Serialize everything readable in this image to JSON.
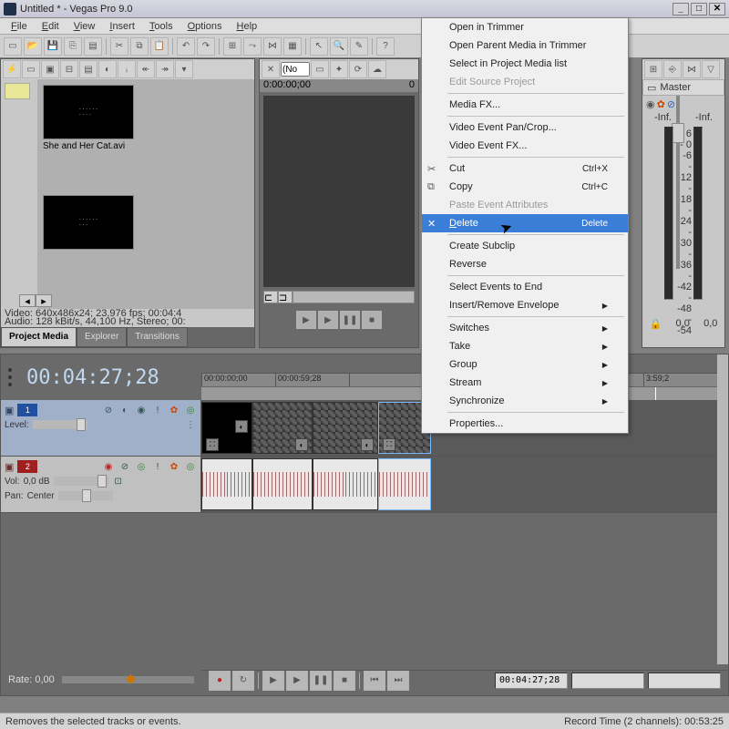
{
  "window": {
    "title": "Untitled * - Vegas Pro 9.0"
  },
  "menubar": [
    "File",
    "Edit",
    "View",
    "Insert",
    "Tools",
    "Options",
    "Help"
  ],
  "project_media": {
    "media_name": "She and Her Cat.avi",
    "info_line1": "Video: 640x486x24; 23,976 fps; 00:04:4",
    "info_line2": "Audio: 128 kBit/s, 44,100 Hz, Stereo; 00:",
    "tabs": [
      "Project Media",
      "Explorer",
      "Transitions"
    ]
  },
  "preview": {
    "dropdown_value": "(No",
    "tc_left": "0:00:00;00",
    "tc_right": "0"
  },
  "master": {
    "title": "Master",
    "inf_left": "-Inf.",
    "inf_right": "-Inf.",
    "ticks": [
      "6",
      "0",
      "-6",
      "-12",
      "-18",
      "-24",
      "-30",
      "-36",
      "-42",
      "-48",
      "-54"
    ],
    "bottom_left": "0,0",
    "bottom_right": "0,0"
  },
  "timeline": {
    "timecode": "00:04:27;28",
    "ruler": [
      "00:00:00;00",
      "00:00:59;28",
      "",
      "",
      "",
      "",
      "3:59;2"
    ],
    "tracks": {
      "video": {
        "num": "1"
      },
      "audio": {
        "num": "2",
        "vol_label": "Vol:",
        "vol_val": "0,0 dB",
        "pan_label": "Pan:",
        "pan_val": "Center"
      }
    },
    "rate_label": "Rate: 0,00",
    "tc_box": "00:04:27;28"
  },
  "context_menu": {
    "items": [
      {
        "label": "Open in Trimmer"
      },
      {
        "label": "Open Parent Media in Trimmer"
      },
      {
        "label": "Select in Project Media list"
      },
      {
        "label": "Edit Source Project",
        "disabled": true
      },
      {
        "sep": true
      },
      {
        "label": "Media FX..."
      },
      {
        "sep": true
      },
      {
        "label": "Video Event Pan/Crop..."
      },
      {
        "label": "Video Event FX..."
      },
      {
        "sep": true
      },
      {
        "label": "Cut",
        "icon": "✂",
        "shortcut": "Ctrl+X"
      },
      {
        "label": "Copy",
        "icon": "⧉",
        "shortcut": "Ctrl+C"
      },
      {
        "label": "Paste Event Attributes",
        "disabled": true
      },
      {
        "label": "Delete",
        "icon": "✕",
        "shortcut": "Delete",
        "highlight": true
      },
      {
        "sep": true
      },
      {
        "label": "Create Subclip"
      },
      {
        "label": "Reverse"
      },
      {
        "sep": true
      },
      {
        "label": "Select Events to End"
      },
      {
        "label": "Insert/Remove Envelope",
        "sub": true
      },
      {
        "sep": true
      },
      {
        "label": "Switches",
        "sub": true
      },
      {
        "label": "Take",
        "sub": true
      },
      {
        "label": "Group",
        "sub": true
      },
      {
        "label": "Stream",
        "sub": true
      },
      {
        "label": "Synchronize",
        "sub": true
      },
      {
        "sep": true
      },
      {
        "label": "Properties..."
      }
    ]
  },
  "statusbar": {
    "left": "Removes the selected tracks or events.",
    "right": "Record Time (2 channels): 00:53:25"
  }
}
